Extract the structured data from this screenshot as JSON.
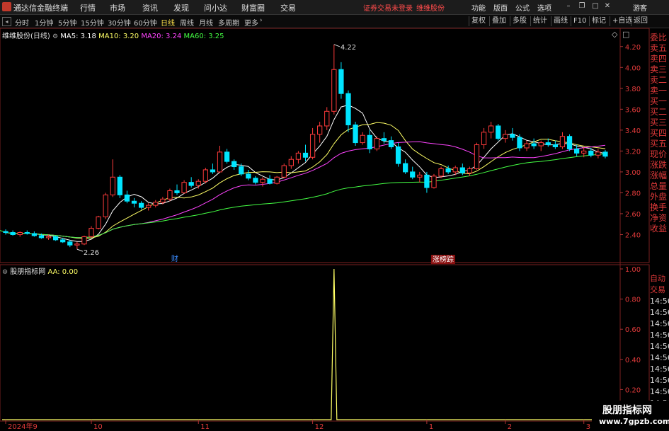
{
  "app": {
    "name": "通达信金融终端",
    "menus": [
      "行情",
      "市场",
      "资讯",
      "发现",
      "问小达",
      "财富圈",
      "交易"
    ],
    "notice": "证券交易未登录",
    "stock_name": "维维股份",
    "right_menus": [
      "功能",
      "版面",
      "公式",
      "选项"
    ],
    "user": "游客"
  },
  "periods": [
    "分时",
    "1分钟",
    "5分钟",
    "15分钟",
    "30分钟",
    "60分钟",
    "日线",
    "周线",
    "月线",
    "多周期",
    "更多"
  ],
  "active_period": "日线",
  "toolbar": [
    "复权",
    "叠加",
    "多股",
    "统计",
    "画线",
    "F10",
    "标记",
    "+自选",
    "返回"
  ],
  "main_panel": {
    "title": "维维股份(日线)",
    "ma": [
      {
        "label": "MA5: 3.18",
        "color": "#ffffff"
      },
      {
        "label": "MA10: 3.20",
        "color": "#ffff66"
      },
      {
        "label": "MA20: 3.24",
        "color": "#ff44ff"
      },
      {
        "label": "MA60: 3.25",
        "color": "#44ff44"
      }
    ],
    "y_ticks": [
      "4.20",
      "4.00",
      "3.80",
      "3.60",
      "3.40",
      "3.20",
      "3.00",
      "2.80",
      "2.60",
      "2.40"
    ],
    "high_label": "4.22",
    "low_label": "2.26",
    "marker_cai": "财",
    "marker_zt": "涨榜踪"
  },
  "sub_panel": {
    "title": "股朋指标网",
    "aa": "AA: 0.00",
    "y_ticks": [
      "1.00",
      "0.80",
      "0.60",
      "0.40",
      "0.20"
    ]
  },
  "x_labels": [
    "2024年9",
    "10",
    "11",
    "12",
    "1",
    "2",
    "3"
  ],
  "right_list_top": [
    "委比",
    "卖五",
    "卖四",
    "卖三",
    "卖二",
    "卖一",
    "买一",
    "买二",
    "买三",
    "买四",
    "买五",
    "现价",
    "涨跌",
    "涨幅",
    "总量",
    "外盘",
    "换手",
    "净资",
    "收益"
  ],
  "right_list_bottom": {
    "head1": "自动",
    "head2": "交易",
    "times": [
      "14:56",
      "14:56",
      "14:56",
      "14:56",
      "14:56",
      "14:56",
      "14:56",
      "14:56",
      "14:56",
      "14:56"
    ]
  },
  "watermark": {
    "line1": "股朋指标网",
    "line2": "www.7gpzb.com"
  },
  "colors": {
    "up": "#ff3b3b",
    "down": "#00e5ff",
    "ma5": "#ffffff",
    "ma10": "#ffff66",
    "ma20": "#ff44ff",
    "ma60": "#44ff44",
    "indicator": "#ffff66",
    "axis_label": "#e03a3a"
  },
  "chart_data": {
    "type": "candlestick",
    "ylim": [
      2.2,
      4.3
    ],
    "candles": [
      [
        2.43,
        2.45,
        2.4,
        2.42
      ],
      [
        2.42,
        2.44,
        2.39,
        2.4
      ],
      [
        2.4,
        2.43,
        2.38,
        2.42
      ],
      [
        2.42,
        2.44,
        2.4,
        2.41
      ],
      [
        2.41,
        2.43,
        2.38,
        2.39
      ],
      [
        2.39,
        2.41,
        2.36,
        2.37
      ],
      [
        2.37,
        2.4,
        2.35,
        2.38
      ],
      [
        2.38,
        2.39,
        2.34,
        2.35
      ],
      [
        2.35,
        2.37,
        2.32,
        2.33
      ],
      [
        2.33,
        2.35,
        2.28,
        2.3
      ],
      [
        2.3,
        2.33,
        2.26,
        2.31
      ],
      [
        2.31,
        2.39,
        2.3,
        2.38
      ],
      [
        2.38,
        2.48,
        2.37,
        2.46
      ],
      [
        2.46,
        2.58,
        2.45,
        2.57
      ],
      [
        2.57,
        2.8,
        2.55,
        2.78
      ],
      [
        2.78,
        3.12,
        2.76,
        2.95
      ],
      [
        2.95,
        2.97,
        2.75,
        2.78
      ],
      [
        2.78,
        2.82,
        2.7,
        2.72
      ],
      [
        2.72,
        2.75,
        2.66,
        2.7
      ],
      [
        2.7,
        2.72,
        2.64,
        2.66
      ],
      [
        2.66,
        2.7,
        2.63,
        2.68
      ],
      [
        2.68,
        2.73,
        2.66,
        2.71
      ],
      [
        2.71,
        2.76,
        2.69,
        2.74
      ],
      [
        2.74,
        2.84,
        2.72,
        2.82
      ],
      [
        2.82,
        2.88,
        2.78,
        2.8
      ],
      [
        2.8,
        2.92,
        2.79,
        2.9
      ],
      [
        2.9,
        2.95,
        2.85,
        2.87
      ],
      [
        2.87,
        2.93,
        2.84,
        2.91
      ],
      [
        2.91,
        3.04,
        2.89,
        3.02
      ],
      [
        3.02,
        3.08,
        2.98,
        3.0
      ],
      [
        3.0,
        3.25,
        2.99,
        3.19
      ],
      [
        3.19,
        3.22,
        3.08,
        3.1
      ],
      [
        3.1,
        3.12,
        3.02,
        3.05
      ],
      [
        3.05,
        3.08,
        2.96,
        2.98
      ],
      [
        2.98,
        3.02,
        2.92,
        2.94
      ],
      [
        2.94,
        2.96,
        2.88,
        2.9
      ],
      [
        2.9,
        2.95,
        2.86,
        2.93
      ],
      [
        2.93,
        2.97,
        2.88,
        2.89
      ],
      [
        2.89,
        2.96,
        2.88,
        2.95
      ],
      [
        2.95,
        3.08,
        2.94,
        3.06
      ],
      [
        3.06,
        3.15,
        3.03,
        3.12
      ],
      [
        3.12,
        3.2,
        3.08,
        3.18
      ],
      [
        3.18,
        3.26,
        3.1,
        3.14
      ],
      [
        3.14,
        3.42,
        3.12,
        3.36
      ],
      [
        3.36,
        3.48,
        3.28,
        3.44
      ],
      [
        3.44,
        3.62,
        3.4,
        3.58
      ],
      [
        3.58,
        4.22,
        3.55,
        3.98
      ],
      [
        3.98,
        4.05,
        3.7,
        3.75
      ],
      [
        3.75,
        3.78,
        3.38,
        3.45
      ],
      [
        3.45,
        3.48,
        3.25,
        3.28
      ],
      [
        3.28,
        3.38,
        3.26,
        3.35
      ],
      [
        3.35,
        3.4,
        3.18,
        3.22
      ],
      [
        3.22,
        3.34,
        3.2,
        3.32
      ],
      [
        3.32,
        3.38,
        3.27,
        3.3
      ],
      [
        3.3,
        3.34,
        3.22,
        3.24
      ],
      [
        3.24,
        3.28,
        3.05,
        3.08
      ],
      [
        3.08,
        3.12,
        2.98,
        3.0
      ],
      [
        3.0,
        3.05,
        2.93,
        2.95
      ],
      [
        2.95,
        3.0,
        2.9,
        2.97
      ],
      [
        2.97,
        3.0,
        2.8,
        2.85
      ],
      [
        2.85,
        2.98,
        2.84,
        2.96
      ],
      [
        2.96,
        3.05,
        2.94,
        3.03
      ],
      [
        3.03,
        3.06,
        2.98,
        3.0
      ],
      [
        3.0,
        3.06,
        2.97,
        3.04
      ],
      [
        3.04,
        3.08,
        2.97,
        2.99
      ],
      [
        2.99,
        3.05,
        2.96,
        3.03
      ],
      [
        3.03,
        3.28,
        3.02,
        3.26
      ],
      [
        3.26,
        3.42,
        3.22,
        3.38
      ],
      [
        3.38,
        3.48,
        3.32,
        3.44
      ],
      [
        3.44,
        3.46,
        3.3,
        3.32
      ],
      [
        3.32,
        3.4,
        3.28,
        3.36
      ],
      [
        3.36,
        3.42,
        3.3,
        3.33
      ],
      [
        3.33,
        3.36,
        3.2,
        3.23
      ],
      [
        3.23,
        3.3,
        3.2,
        3.27
      ],
      [
        3.27,
        3.32,
        3.22,
        3.25
      ],
      [
        3.25,
        3.3,
        3.2,
        3.28
      ],
      [
        3.28,
        3.32,
        3.24,
        3.26
      ],
      [
        3.26,
        3.3,
        3.22,
        3.24
      ],
      [
        3.24,
        3.38,
        3.22,
        3.34
      ],
      [
        3.34,
        3.36,
        3.2,
        3.22
      ],
      [
        3.22,
        3.26,
        3.15,
        3.18
      ],
      [
        3.18,
        3.24,
        3.14,
        3.2
      ],
      [
        3.2,
        3.23,
        3.14,
        3.16
      ],
      [
        3.16,
        3.22,
        3.13,
        3.19
      ],
      [
        3.19,
        3.21,
        3.13,
        3.15
      ]
    ],
    "indicator": {
      "name": "AA",
      "spike_index": 46,
      "spike_value": 1.0
    }
  }
}
